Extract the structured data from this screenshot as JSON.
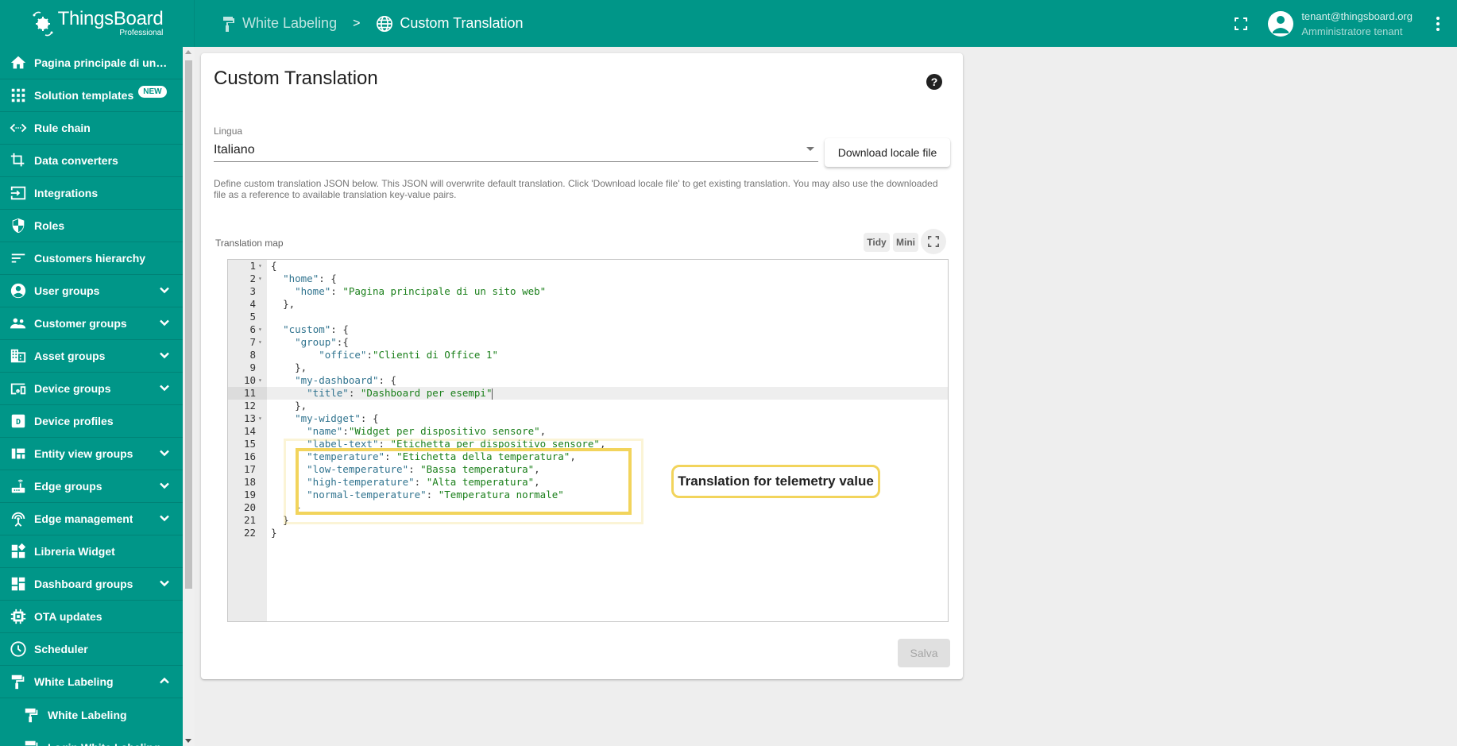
{
  "app": {
    "logo_name": "ThingsBoard",
    "logo_sub": "Professional",
    "brand_color": "#009688",
    "highlight_color": "#f2d45c"
  },
  "breadcrumb": [
    {
      "label": "White Labeling",
      "icon": "paint-roller-icon"
    },
    {
      "label": "Custom Translation",
      "icon": "globe-icon"
    }
  ],
  "breadcrumb_separator": ">",
  "user": {
    "email": "tenant@thingsboard.org",
    "role": "Amministratore tenant"
  },
  "sidebar": {
    "items": [
      {
        "label": "Pagina principale di un sito web",
        "icon": "home-icon"
      },
      {
        "label": "Solution templates",
        "icon": "apps-icon",
        "badge": "NEW"
      },
      {
        "label": "Rule chain",
        "icon": "settings-ethernet-icon"
      },
      {
        "label": "Data converters",
        "icon": "transform-icon"
      },
      {
        "label": "Integrations",
        "icon": "input-icon"
      },
      {
        "label": "Roles",
        "icon": "security-icon"
      },
      {
        "label": "Customers hierarchy",
        "icon": "sort-icon"
      },
      {
        "label": "User groups",
        "icon": "account-circle-icon",
        "expandable": true
      },
      {
        "label": "Customer groups",
        "icon": "supervisor-account-icon",
        "expandable": true
      },
      {
        "label": "Asset groups",
        "icon": "domain-icon",
        "expandable": true
      },
      {
        "label": "Device groups",
        "icon": "devices-other-icon",
        "expandable": true
      },
      {
        "label": "Device profiles",
        "icon": "device-profile-icon"
      },
      {
        "label": "Entity view groups",
        "icon": "view-quilt-icon",
        "expandable": true
      },
      {
        "label": "Edge groups",
        "icon": "router-icon",
        "expandable": true
      },
      {
        "label": "Edge management",
        "icon": "settings-input-antenna-icon",
        "expandable": true
      },
      {
        "label": "Libreria Widget",
        "icon": "widgets-icon"
      },
      {
        "label": "Dashboard groups",
        "icon": "dashboard-icon",
        "expandable": true
      },
      {
        "label": "OTA updates",
        "icon": "memory-icon"
      },
      {
        "label": "Scheduler",
        "icon": "schedule-icon"
      },
      {
        "label": "White Labeling",
        "icon": "format-paint-icon",
        "expanded": true
      },
      {
        "label": "White Labeling",
        "icon": "format-paint-icon",
        "sub": true
      },
      {
        "label": "Login White Labeling",
        "icon": "format-paint-icon",
        "sub": true
      }
    ]
  },
  "card": {
    "title": "Custom Translation",
    "language_label": "Lingua",
    "language_value": "Italiano",
    "download_button": "Download locale file",
    "hint": "Define custom translation JSON below. This JSON will overwrite default translation. Click 'Download locale file' to get existing translation. You may also use the downloaded file as a reference to available translation key-value pairs.",
    "map_label": "Translation map",
    "tidy_label": "Tidy",
    "mini_label": "Mini",
    "save_button": "Salva",
    "callout": "Translation for telemetry value"
  },
  "editor": {
    "current_line": 11,
    "lines": [
      {
        "n": "1",
        "fold": true,
        "indent": 0,
        "parts": [
          [
            "p",
            "{"
          ]
        ]
      },
      {
        "n": "2",
        "fold": true,
        "indent": 2,
        "parts": [
          [
            "k",
            "\"home\""
          ],
          [
            "p",
            ": {"
          ]
        ]
      },
      {
        "n": "3",
        "fold": false,
        "indent": 4,
        "parts": [
          [
            "k",
            "\"home\""
          ],
          [
            "p",
            ": "
          ],
          [
            "s",
            "\"Pagina principale di un sito web\""
          ]
        ]
      },
      {
        "n": "4",
        "fold": false,
        "indent": 2,
        "parts": [
          [
            "p",
            "},"
          ]
        ]
      },
      {
        "n": "5",
        "fold": false,
        "indent": 0,
        "parts": []
      },
      {
        "n": "6",
        "fold": true,
        "indent": 2,
        "parts": [
          [
            "k",
            "\"custom\""
          ],
          [
            "p",
            ": {"
          ]
        ]
      },
      {
        "n": "7",
        "fold": true,
        "indent": 4,
        "parts": [
          [
            "k",
            "\"group\""
          ],
          [
            "p",
            ":{"
          ]
        ]
      },
      {
        "n": "8",
        "fold": false,
        "indent": 8,
        "parts": [
          [
            "k",
            "\"office\""
          ],
          [
            "p",
            ":"
          ],
          [
            "s",
            "\"Clienti di Office 1\""
          ]
        ]
      },
      {
        "n": "9",
        "fold": false,
        "indent": 4,
        "parts": [
          [
            "p",
            "},"
          ]
        ]
      },
      {
        "n": "10",
        "fold": true,
        "indent": 4,
        "parts": [
          [
            "k",
            "\"my-dashboard\""
          ],
          [
            "p",
            ": {"
          ]
        ]
      },
      {
        "n": "11",
        "fold": false,
        "indent": 6,
        "parts": [
          [
            "k",
            "\"title\""
          ],
          [
            "p",
            ": "
          ],
          [
            "s",
            "\"Dashboard per esempi\""
          ]
        ]
      },
      {
        "n": "12",
        "fold": false,
        "indent": 4,
        "parts": [
          [
            "p",
            "},"
          ]
        ]
      },
      {
        "n": "13",
        "fold": true,
        "indent": 4,
        "parts": [
          [
            "k",
            "\"my-widget\""
          ],
          [
            "p",
            ": {"
          ]
        ]
      },
      {
        "n": "14",
        "fold": false,
        "indent": 6,
        "parts": [
          [
            "k",
            "\"name\""
          ],
          [
            "p",
            ":"
          ],
          [
            "s",
            "\"Widget per dispositivo sensore\""
          ],
          [
            "p",
            ","
          ]
        ]
      },
      {
        "n": "15",
        "fold": false,
        "indent": 6,
        "parts": [
          [
            "k",
            "\"label-text\""
          ],
          [
            "p",
            ": "
          ],
          [
            "s",
            "\"Etichetta per dispositivo sensore\""
          ],
          [
            "p",
            ","
          ]
        ]
      },
      {
        "n": "16",
        "fold": false,
        "indent": 6,
        "parts": [
          [
            "k",
            "\"temperature\""
          ],
          [
            "p",
            ": "
          ],
          [
            "s",
            "\"Etichetta della temperatura\""
          ],
          [
            "p",
            ","
          ]
        ]
      },
      {
        "n": "17",
        "fold": false,
        "indent": 6,
        "parts": [
          [
            "k",
            "\"low-temperature\""
          ],
          [
            "p",
            ": "
          ],
          [
            "s",
            "\"Bassa temperatura\""
          ],
          [
            "p",
            ","
          ]
        ]
      },
      {
        "n": "18",
        "fold": false,
        "indent": 6,
        "parts": [
          [
            "k",
            "\"high-temperature\""
          ],
          [
            "p",
            ": "
          ],
          [
            "s",
            "\"Alta temperatura\""
          ],
          [
            "p",
            ","
          ]
        ]
      },
      {
        "n": "19",
        "fold": false,
        "indent": 6,
        "parts": [
          [
            "k",
            "\"normal-temperature\""
          ],
          [
            "p",
            ": "
          ],
          [
            "s",
            "\"Temperatura normale\""
          ]
        ]
      },
      {
        "n": "20",
        "fold": false,
        "indent": 4,
        "parts": [
          [
            "p",
            "}"
          ]
        ]
      },
      {
        "n": "21",
        "fold": false,
        "indent": 2,
        "parts": [
          [
            "p",
            "}"
          ]
        ]
      },
      {
        "n": "22",
        "fold": false,
        "indent": 0,
        "parts": [
          [
            "p",
            "}"
          ]
        ]
      }
    ]
  }
}
